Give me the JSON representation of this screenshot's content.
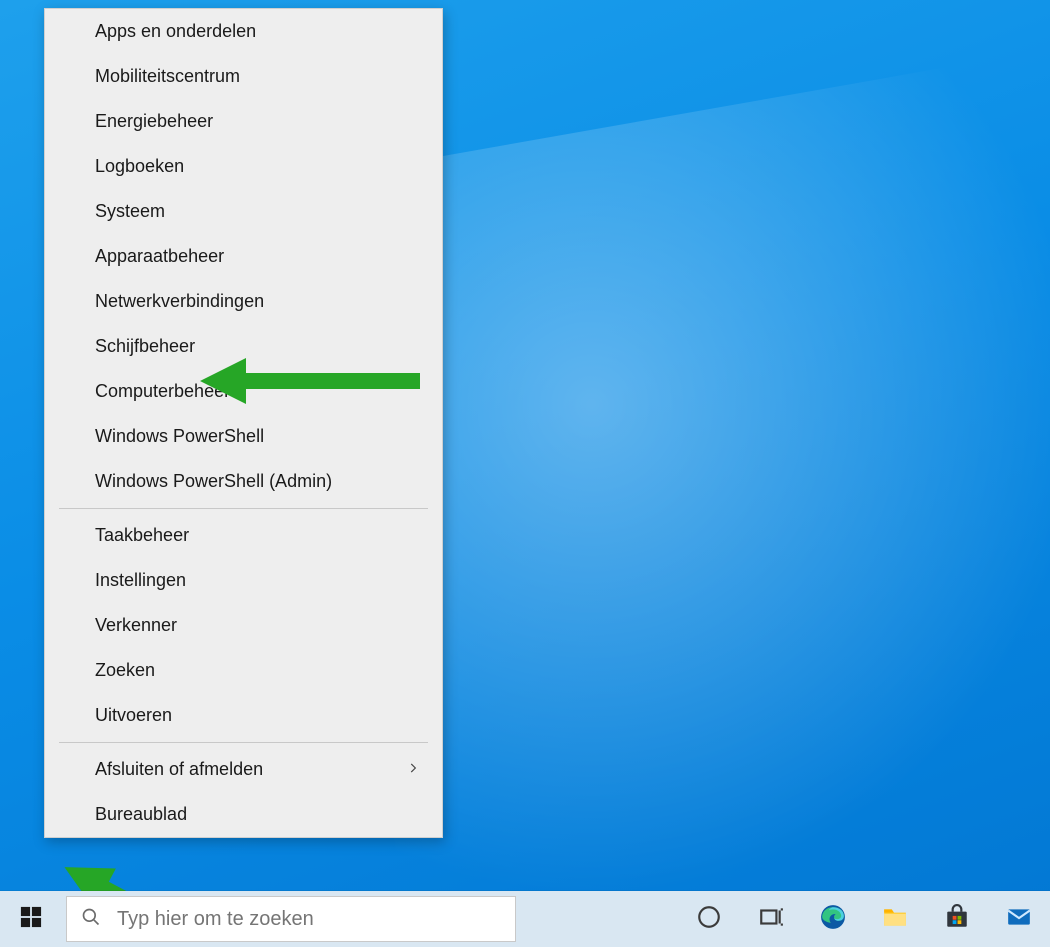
{
  "search": {
    "placeholder": "Typ hier om te zoeken"
  },
  "ctx": {
    "items_a": [
      "Apps en onderdelen",
      "Mobiliteitscentrum",
      "Energiebeheer",
      "Logboeken",
      "Systeem",
      "Apparaatbeheer",
      "Netwerkverbindingen",
      "Schijfbeheer",
      "Computerbeheer",
      "Windows PowerShell",
      "Windows PowerShell (Admin)"
    ],
    "items_b": [
      "Taakbeheer",
      "Instellingen",
      "Verkenner",
      "Zoeken",
      "Uitvoeren"
    ],
    "shutdown": "Afsluiten of afmelden",
    "desktop": "Bureaublad"
  },
  "taskbar": {
    "icons": [
      "cortana",
      "taskview",
      "edge",
      "explorer",
      "store",
      "mail"
    ]
  },
  "annotation": {
    "arrow_color": "#26a626",
    "highlighted_item_index": 7
  }
}
